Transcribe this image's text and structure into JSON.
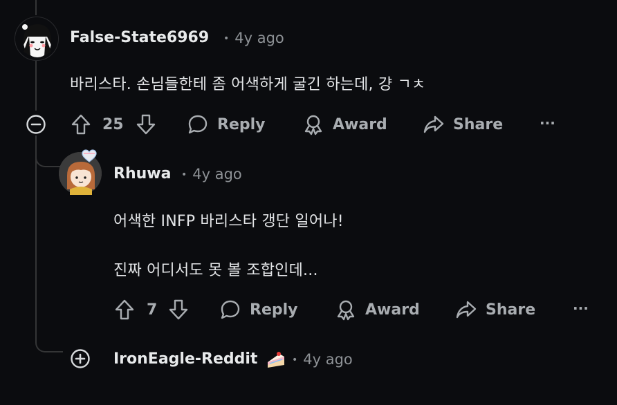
{
  "comments": [
    {
      "username": "False-State6969",
      "time": "4y ago",
      "body": [
        "바리스타. 손님들한테 좀 어색하게 굴긴 하는데, 걍 ㄱㅊ"
      ],
      "votes": "25",
      "actions": {
        "reply": "Reply",
        "award": "Award",
        "share": "Share",
        "more": "···"
      }
    },
    {
      "username": "Rhuwa",
      "time": "4y ago",
      "body": [
        "어색한 INFP 바리스타 갱단 일어나!",
        "진짜 어디서도 못 볼 조합인데..."
      ],
      "votes": "7",
      "actions": {
        "reply": "Reply",
        "award": "Award",
        "share": "Share",
        "more": "···"
      }
    },
    {
      "username": "IronEagle-Reddit",
      "time": "4y ago",
      "flair_emoji": "🍰"
    }
  ],
  "colors": {
    "background": "#0b0c0f",
    "thread_line": "#343536",
    "text": "#d7dadc",
    "muted": "#8e9296"
  }
}
